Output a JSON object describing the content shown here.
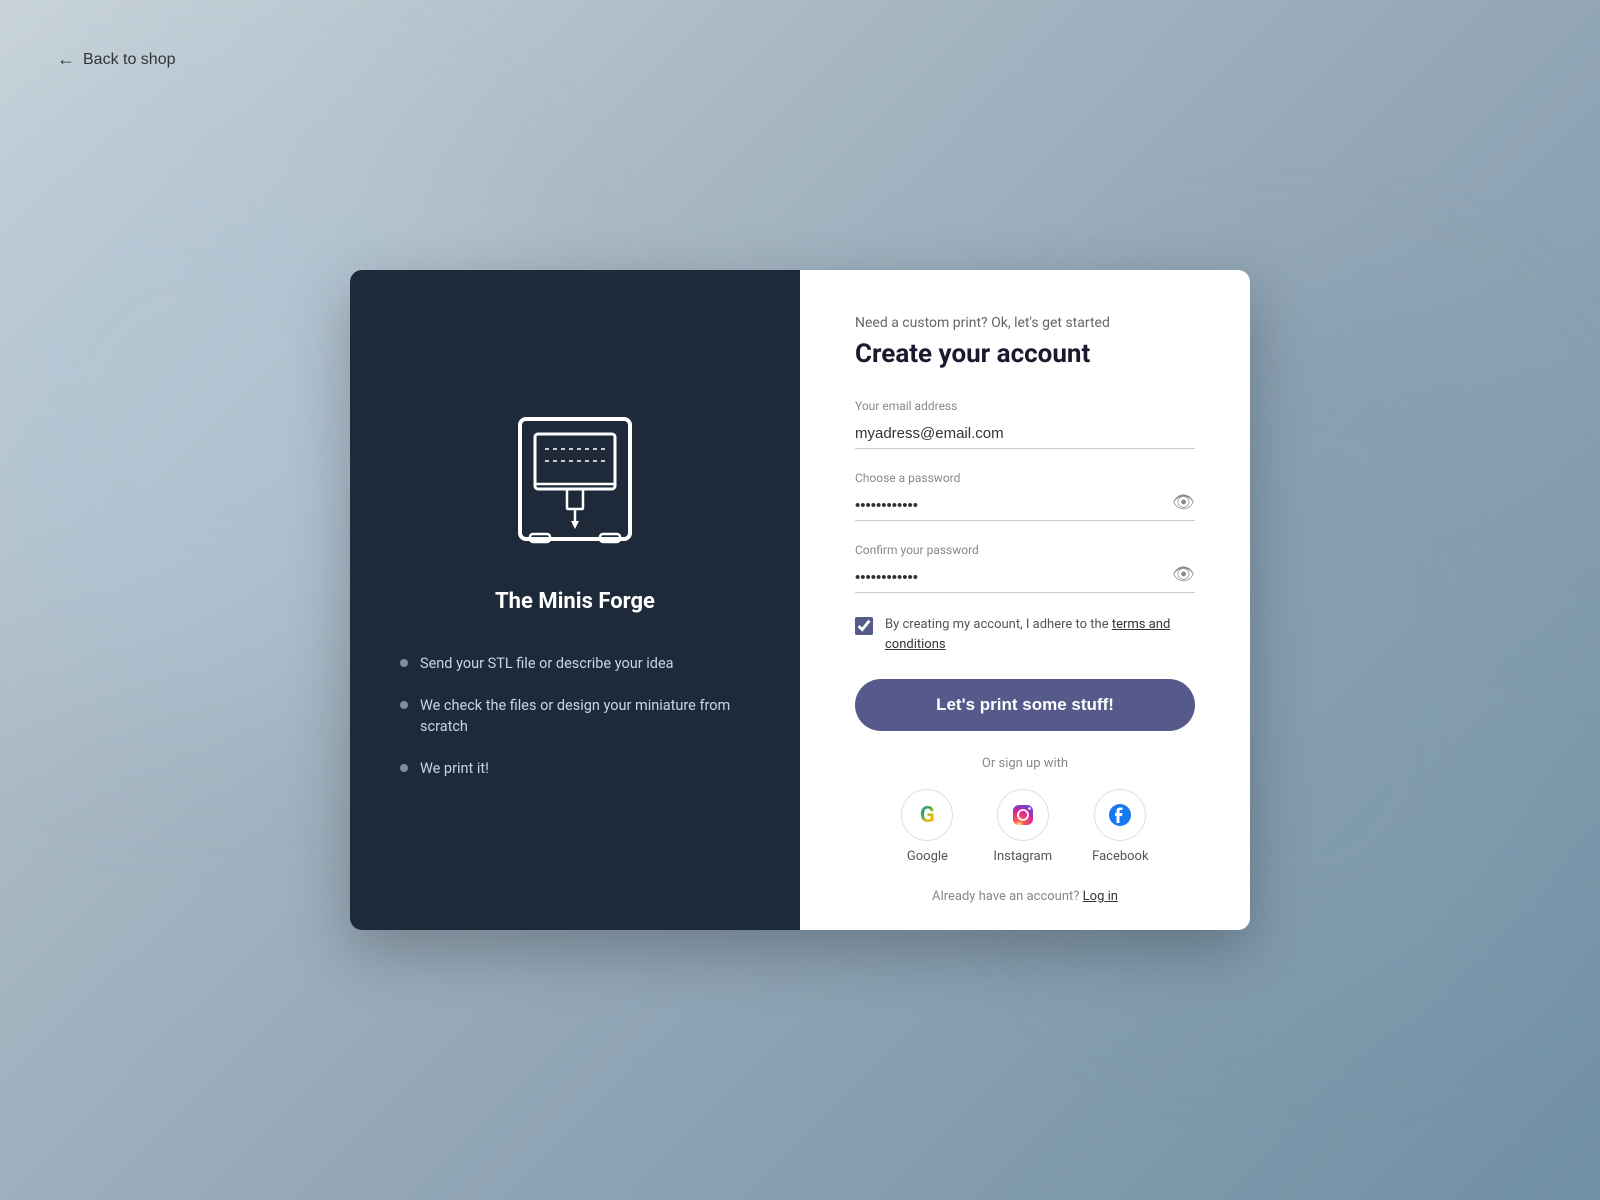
{
  "back_link": {
    "label": "Back to shop",
    "arrow": "←"
  },
  "left_panel": {
    "brand_name": "The Minis Forge",
    "features": [
      "Send your STL file or describe your idea",
      "We check the files or design your miniature from scratch",
      "We print it!"
    ]
  },
  "right_panel": {
    "subtitle": "Need a custom print? Ok, let's get started",
    "title": "Create your account",
    "email_label": "Your email address",
    "email_value": "myadress@email.com",
    "password_label": "Choose a password",
    "password_value": "············",
    "confirm_label": "Confirm your password",
    "confirm_value": "············",
    "terms_text_before": "By creating my account, I adhere to the ",
    "terms_link_text": "terms and conditions",
    "cta_label": "Let's print some stuff!",
    "or_text": "Or sign up with",
    "social": [
      {
        "name": "Google",
        "label": "Google"
      },
      {
        "name": "Instagram",
        "label": "Instagram"
      },
      {
        "name": "Facebook",
        "label": "Facebook"
      }
    ],
    "already_text": "Already have an account?",
    "login_label": "Log in"
  },
  "colors": {
    "left_bg": "#1e2a3a",
    "button_bg": "#555a8a",
    "accent": "#555a8a"
  }
}
